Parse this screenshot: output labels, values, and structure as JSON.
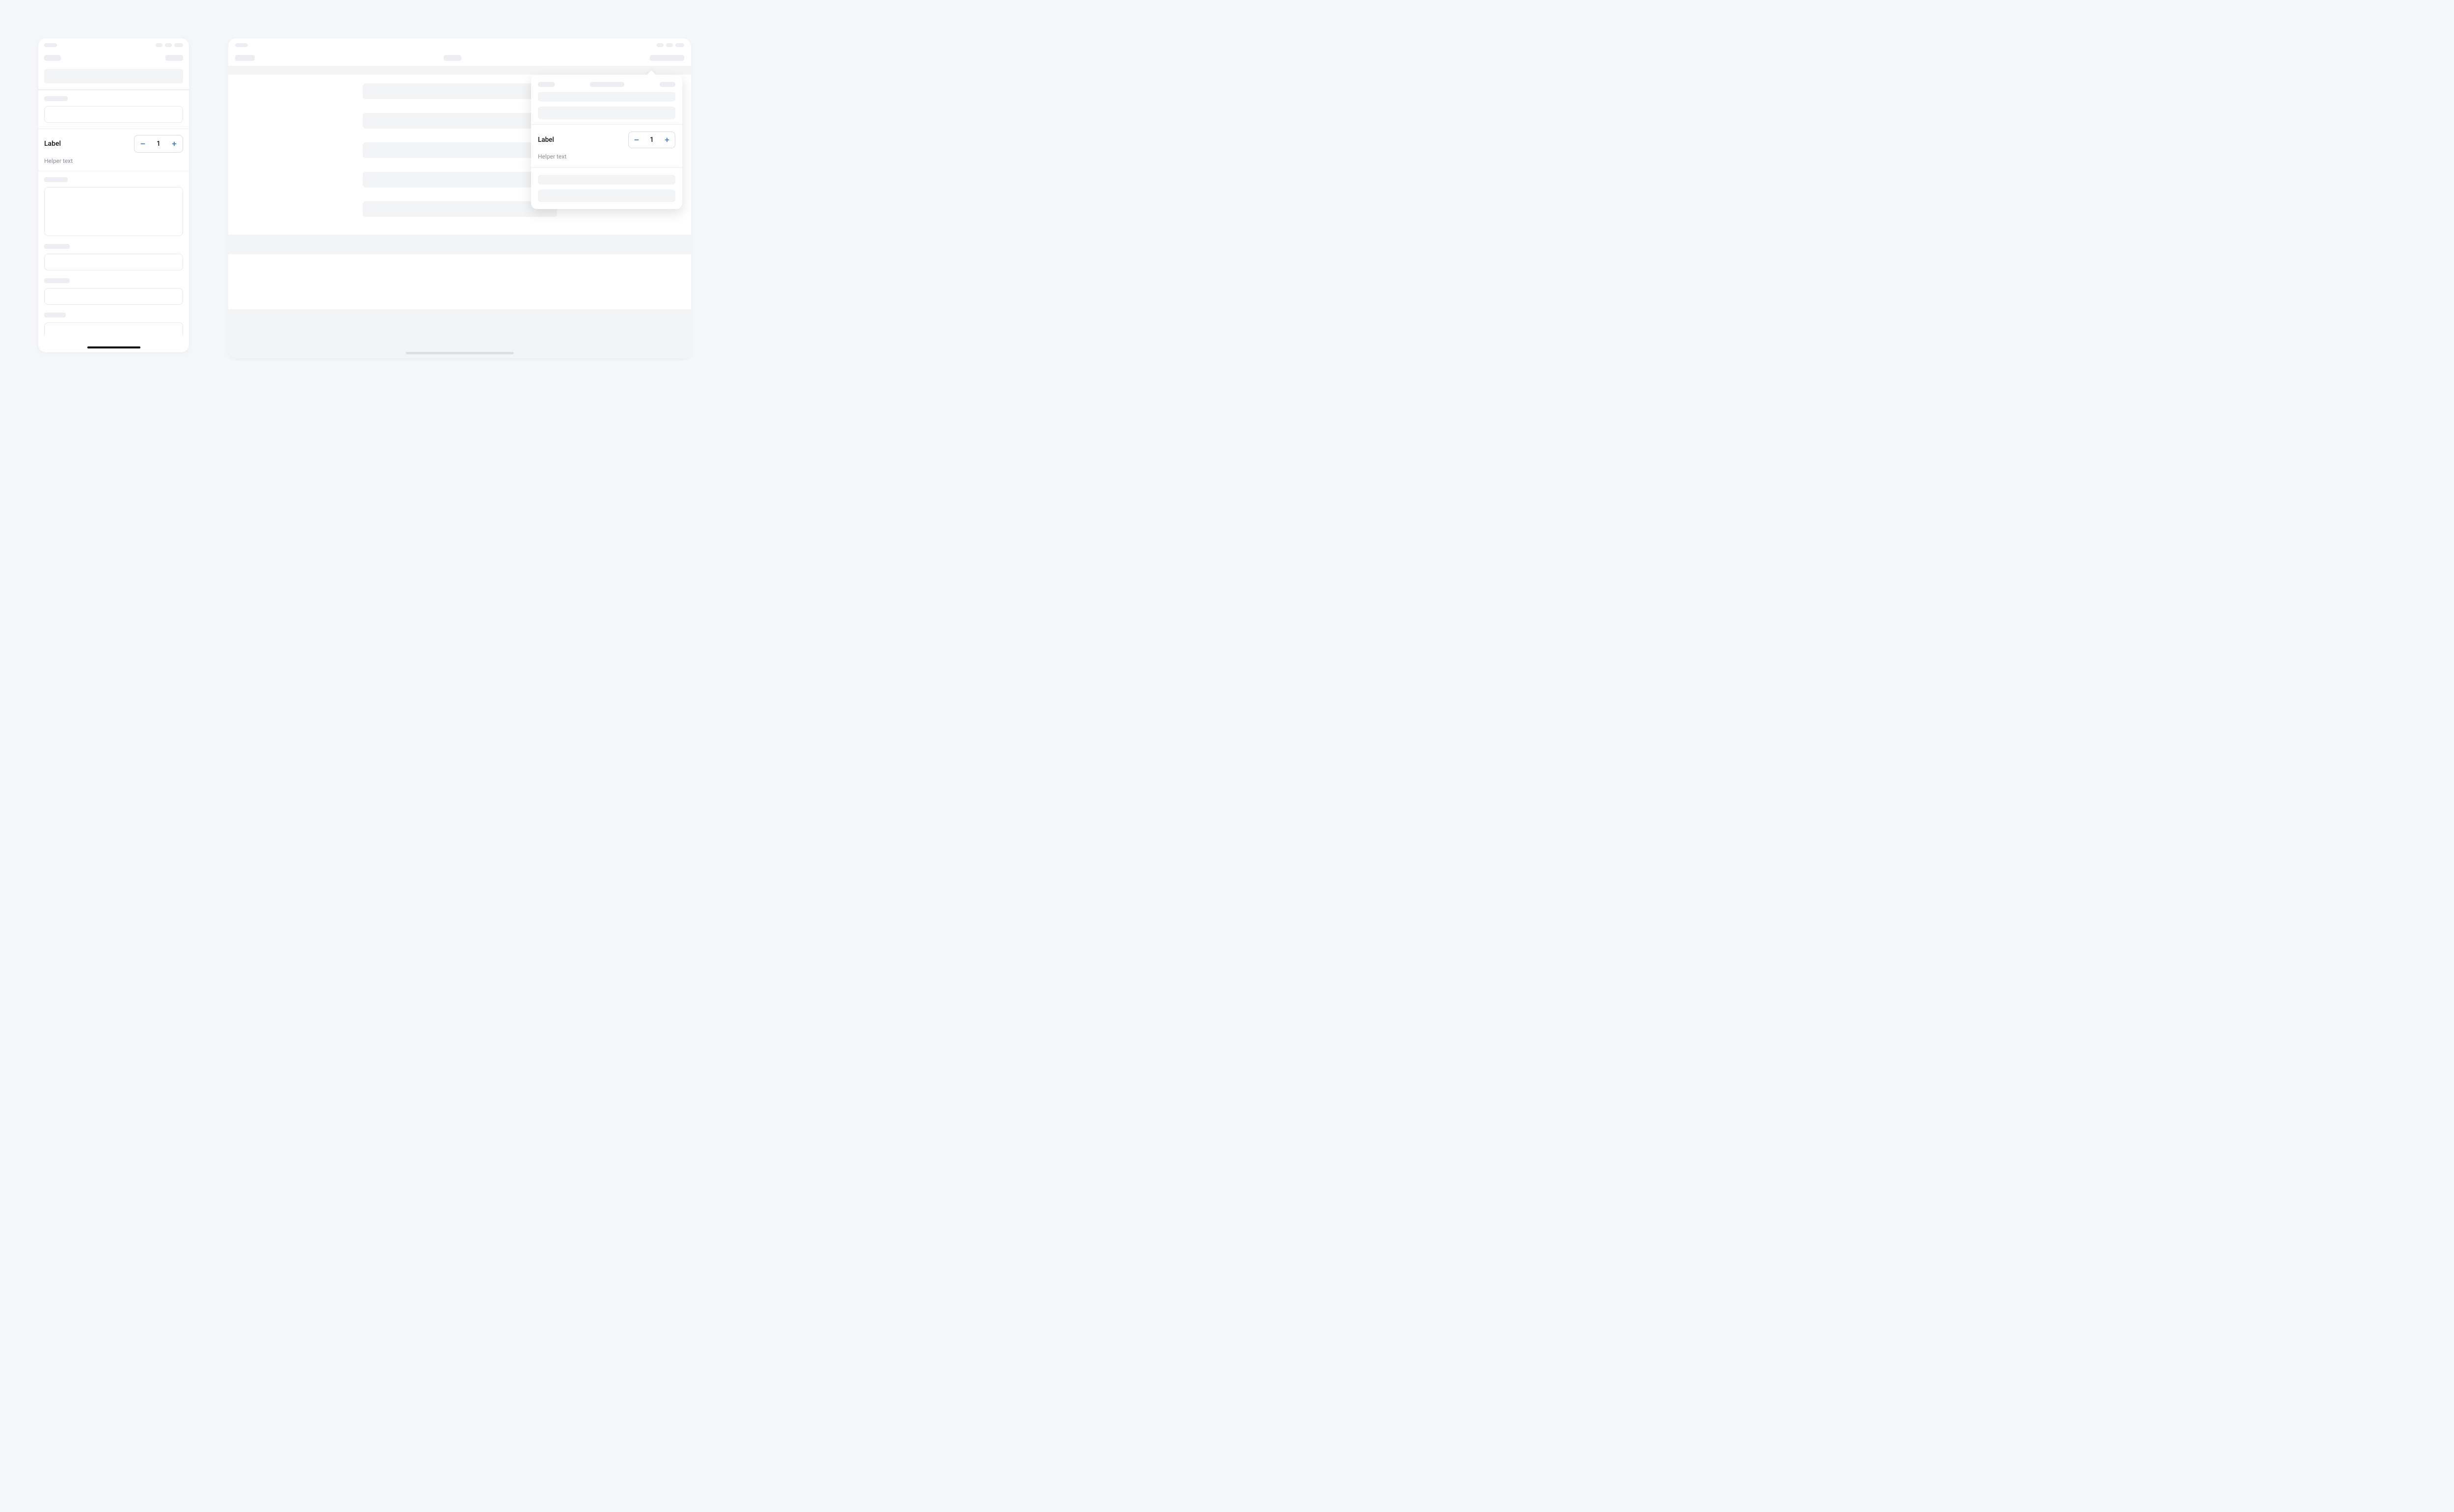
{
  "mobile": {
    "stepper": {
      "label": "Label",
      "value": "1",
      "helper": "Helper text"
    }
  },
  "tablet": {
    "popover": {
      "stepper": {
        "label": "Label",
        "value": "1",
        "helper": "Helper text"
      }
    }
  },
  "colors": {
    "accent": "#1f6ee6"
  }
}
